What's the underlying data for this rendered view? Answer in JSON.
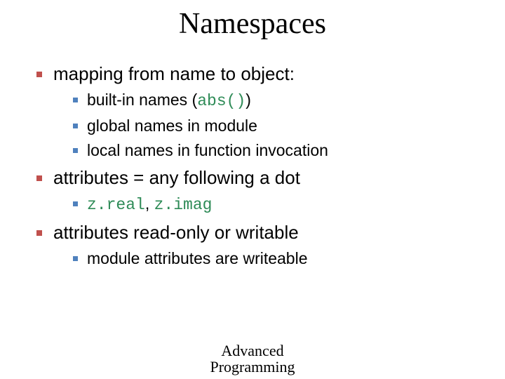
{
  "title": "Namespaces",
  "bullets": {
    "b1": {
      "text": "mapping from name to object:",
      "sub": {
        "s1_pre": "built-in names (",
        "s1_code": "abs()",
        "s1_post": ")",
        "s2": "global names in module",
        "s3": "local names in function invocation"
      }
    },
    "b2": {
      "text": "attributes = any following a dot",
      "sub": {
        "s1_code1": "z.real",
        "s1_sep": ", ",
        "s1_code2": "z.imag"
      }
    },
    "b3": {
      "text": "attributes read-only or writable",
      "sub": {
        "s1": "module attributes are writeable"
      }
    }
  },
  "footer": {
    "line1": "Advanced",
    "line2": "Programming"
  }
}
